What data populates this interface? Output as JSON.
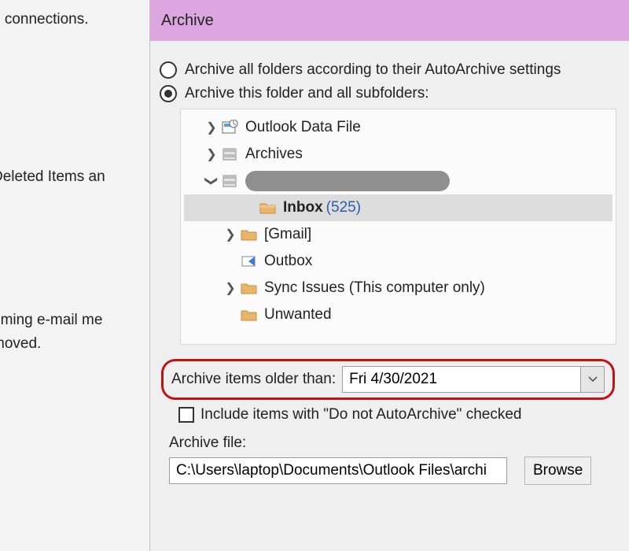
{
  "background": {
    "line1": "e connections.",
    "line2": "Deleted Items an",
    "line3": "oming e-mail me",
    "line4": "moved."
  },
  "dialog": {
    "title": "Archive",
    "radio1": "Archive all folders according to their AutoArchive settings",
    "radio2": "Archive this folder and all subfolders:",
    "tree": {
      "n0": "Outlook Data File",
      "n1": "Archives",
      "n3": "Inbox",
      "n3count": "(525)",
      "n4": "[Gmail]",
      "n5": "Outbox",
      "n6": "Sync Issues (This computer only)",
      "n7": "Unwanted"
    },
    "olderLabel": "Archive items older than:",
    "olderValue": "Fri 4/30/2021",
    "includeLabel": "Include items with \"Do not AutoArchive\" checked",
    "fileLabel": "Archive file:",
    "filePath": "C:\\Users\\laptop\\Documents\\Outlook Files\\archi",
    "browse": "Browse"
  }
}
